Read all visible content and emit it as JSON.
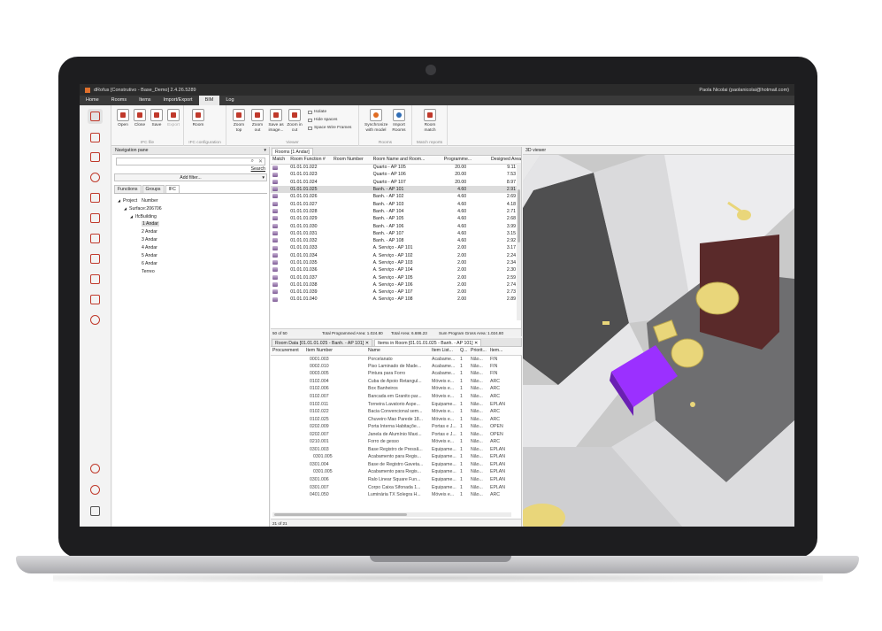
{
  "window": {
    "title": "dRofus [Construtivo - Base_Demo] 2.4.26.5289",
    "user": "Paola Nicolai (paolanicolai@hotmail.com)"
  },
  "menu": [
    "Home",
    "Rooms",
    "Items",
    "Import/Export",
    "BIM",
    "Log"
  ],
  "menu_active": "BIM",
  "ribbon": {
    "ifc_file": {
      "label": "IFC file",
      "open": "Open",
      "close": "Close",
      "save": "Save",
      "export": "Export"
    },
    "ifc_config": {
      "label": "IFC configuration",
      "room": "Room"
    },
    "viewer": {
      "label": "Viewer",
      "zoom_top": "Zoom top",
      "zoom_out": "Zoom out",
      "save_image": "Save as image...",
      "zoom_cut": "Zoom in cut",
      "isolate": "Isolate",
      "hide_spaces": "Hide spaces",
      "wire_frames": "Space Wire Frames"
    },
    "rooms": {
      "label": "Rooms",
      "synchronize": "Synchronize with model",
      "import": "Import Rooms"
    },
    "match": {
      "label": "Match reports",
      "room_match": "Room match"
    }
  },
  "nav": {
    "title": "Navigation pane",
    "search_link": "Search",
    "add_filter": "Add filter...",
    "tabs": [
      "Functions",
      "Groups",
      "IFC"
    ],
    "tree": [
      {
        "label": "Project",
        "extra": "Number",
        "depth": 0,
        "exp": "◢"
      },
      {
        "label": "Surface:206706",
        "depth": 1,
        "exp": "◢"
      },
      {
        "label": "IfcBuilding",
        "depth": 2,
        "exp": "◢"
      },
      {
        "label": "1 Andar",
        "depth": 3,
        "exp": "",
        "sel": true
      },
      {
        "label": "2 Andar",
        "depth": 3,
        "exp": ""
      },
      {
        "label": "3 Andar",
        "depth": 3,
        "exp": ""
      },
      {
        "label": "4 Andar",
        "depth": 3,
        "exp": ""
      },
      {
        "label": "5 Andar",
        "depth": 3,
        "exp": ""
      },
      {
        "label": "6 Andar",
        "depth": 3,
        "exp": ""
      },
      {
        "label": "Terreo",
        "depth": 3,
        "exp": ""
      }
    ]
  },
  "rooms": {
    "tab": "Rooms [1 Andar]",
    "columns": [
      "Match",
      "Room Function #",
      "Room Number",
      "Room Name and Room...",
      "Programme...",
      "Designed Area"
    ],
    "rows": [
      [
        "01.01.01.022",
        "",
        "Quarto - AP 105",
        "20.00",
        "9.11"
      ],
      [
        "01.01.01.023",
        "",
        "Quarto - AP 106",
        "20.00",
        "7.53"
      ],
      [
        "01.01.01.024",
        "",
        "Quarto - AP 107",
        "20.00",
        "8.97"
      ],
      [
        "01.01.01.025",
        "",
        "Banh. - AP 101",
        "4.60",
        "2.91"
      ],
      [
        "01.01.01.026",
        "",
        "Banh. - AP 102",
        "4.60",
        "2.69"
      ],
      [
        "01.01.01.027",
        "",
        "Banh. - AP 103",
        "4.60",
        "4.18"
      ],
      [
        "01.01.01.028",
        "",
        "Banh. - AP 104",
        "4.60",
        "2.71"
      ],
      [
        "01.01.01.029",
        "",
        "Banh. - AP 105",
        "4.60",
        "2.68"
      ],
      [
        "01.01.01.030",
        "",
        "Banh. - AP 106",
        "4.60",
        "3.99"
      ],
      [
        "01.01.01.031",
        "",
        "Banh. - AP 107",
        "4.60",
        "3.15"
      ],
      [
        "01.01.01.032",
        "",
        "Banh. - AP 108",
        "4.60",
        "2.92"
      ],
      [
        "01.01.01.033",
        "",
        "A. Serviço - AP 101",
        "2.00",
        "3.17"
      ],
      [
        "01.01.01.034",
        "",
        "A. Serviço - AP 102",
        "2.00",
        "2.24"
      ],
      [
        "01.01.01.035",
        "",
        "A. Serviço - AP 103",
        "2.00",
        "2.34"
      ],
      [
        "01.01.01.036",
        "",
        "A. Serviço - AP 104",
        "2.00",
        "2.30"
      ],
      [
        "01.01.01.037",
        "",
        "A. Serviço - AP 105",
        "2.00",
        "2.59"
      ],
      [
        "01.01.01.038",
        "",
        "A. Serviço - AP 106",
        "2.00",
        "2.74"
      ],
      [
        "01.01.01.039",
        "",
        "A. Serviço - AP 107",
        "2.00",
        "2.73"
      ],
      [
        "01.01.01.040",
        "",
        "A. Serviço - AP 108",
        "2.00",
        "2.89"
      ]
    ],
    "selected_row": 3,
    "status": {
      "count": "50 of 50",
      "programmed": "Total Programmed Area: 1.024.80",
      "total": "Total Area: 6.686.23",
      "gross": "Sum Program Gross Area: 1.024.80"
    }
  },
  "items": {
    "tabs": [
      "Room Data [01.01.01.025 - Banh. - AP 101]",
      "Items in Room [01.01.01.025 - Banh. - AP 101]"
    ],
    "columns": [
      "Procurement",
      "Item Number",
      "Name",
      "Item List...",
      "Q...",
      "Priorit...",
      "Item..."
    ],
    "rows": [
      [
        "",
        "0001.003",
        "Porcelanato",
        "Acabame...",
        "1",
        "Não...",
        "FIN"
      ],
      [
        "",
        "0002.010",
        "Piso Laminado de Made...",
        "Acabame...",
        "1",
        "Não...",
        "FIN"
      ],
      [
        "",
        "0003.005",
        "Pintura para Forro",
        "Acabame...",
        "1",
        "Não...",
        "FIN"
      ],
      [
        "",
        "0102.004",
        "Cuba de Apoio Retangul...",
        "Móveis e...",
        "1",
        "Não...",
        "ARC"
      ],
      [
        "",
        "0102.006",
        "Box Banheiros",
        "Móveis e...",
        "1",
        "Não...",
        "ARC"
      ],
      [
        "",
        "0102.007",
        "Bancada em Granito par...",
        "Móveis e...",
        "1",
        "Não...",
        "ARC"
      ],
      [
        "",
        "0102.011",
        "Torneira Lavatorio Aspe...",
        "Equipame...",
        "1",
        "Não...",
        "EPLAN"
      ],
      [
        "",
        "0102.022",
        "Bacia Convencional sem...",
        "Móveis e...",
        "1",
        "Não...",
        "ARC"
      ],
      [
        "",
        "0102.025",
        "Chuveiro Mao Parede 18...",
        "Móveis e...",
        "1",
        "Não...",
        "ARC"
      ],
      [
        "",
        "0202.009",
        "Porta Interna Habitaçõe...",
        "Portas e J...",
        "1",
        "Não...",
        "OPEN"
      ],
      [
        "",
        "0202.007",
        "Janela de Alumínio Maxi...",
        "Portas e J...",
        "1",
        "Não...",
        "OPEN"
      ],
      [
        "",
        "0210.001",
        "Forro de gesso",
        "Móveis e...",
        "1",
        "Não...",
        "ARC"
      ],
      [
        "",
        "0301.003",
        "Base Registro de Pressã...",
        "Equipame...",
        "1",
        "Não...",
        "EPLAN"
      ],
      [
        "",
        "0301.005",
        "Acabamento para Regis...",
        "Equipame...",
        "1",
        "Não...",
        "EPLAN"
      ],
      [
        "",
        "0301.004",
        "Base de Registro Gaveta...",
        "Equipame...",
        "1",
        "Não...",
        "EPLAN"
      ],
      [
        "",
        "0301.005",
        "Acabamento para Regis...",
        "Equipame...",
        "1",
        "Não...",
        "EPLAN"
      ],
      [
        "",
        "0301.006",
        "Ralo Linear Square Fun...",
        "Equipame...",
        "1",
        "Não...",
        "EPLAN"
      ],
      [
        "",
        "0301.007",
        "Corpo Caixa Sifonada 1...",
        "Equipame...",
        "1",
        "Não...",
        "EPLAN"
      ],
      [
        "",
        "0401.050",
        "Luminária TX Solegra H...",
        "Móveis e...",
        "1",
        "Não...",
        "ARC"
      ]
    ],
    "status": "21 of 21"
  },
  "viewer": {
    "title": "3D viewer"
  },
  "colors": {
    "accent": "#c0392b",
    "selection": "#9b30ff",
    "fixture": "#e9d67a",
    "door": "#5a2a2a"
  }
}
